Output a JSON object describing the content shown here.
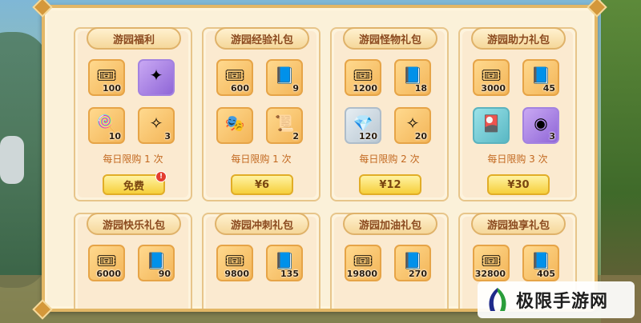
{
  "colors": {
    "accent": "#f6cf3b",
    "title": "#8b4a1f",
    "limit_text": "#c2681f",
    "panel": "#fbf1d9"
  },
  "packs": [
    {
      "title": "游园福利",
      "items": [
        {
          "icon": "ticket-icon",
          "qty": "100"
        },
        {
          "icon": "purple-crystal-icon",
          "qty": ""
        },
        {
          "icon": "lollipop-icon",
          "qty": "10"
        },
        {
          "icon": "gem-icon",
          "qty": "3"
        }
      ],
      "limit": "每日限购 1 次",
      "price": "免费",
      "badge": "!"
    },
    {
      "title": "游园经验礼包",
      "items": [
        {
          "icon": "ticket-icon",
          "qty": "600"
        },
        {
          "icon": "book-icon",
          "qty": "9"
        },
        {
          "icon": "mask-icon",
          "qty": ""
        },
        {
          "icon": "scroll-icon",
          "qty": "2"
        }
      ],
      "limit": "每日限购 1 次",
      "price": "¥6"
    },
    {
      "title": "游园怪物礼包",
      "items": [
        {
          "icon": "ticket-icon",
          "qty": "1200"
        },
        {
          "icon": "book-icon",
          "qty": "18"
        },
        {
          "icon": "crystal-icon",
          "qty": "120"
        },
        {
          "icon": "gem-icon",
          "qty": "20"
        }
      ],
      "limit": "每日限购 2 次",
      "price": "¥12"
    },
    {
      "title": "游园助力礼包",
      "items": [
        {
          "icon": "ticket-icon",
          "qty": "3000"
        },
        {
          "icon": "book-icon",
          "qty": "45"
        },
        {
          "icon": "card-icon",
          "qty": ""
        },
        {
          "icon": "eye-orb-icon",
          "qty": "3"
        }
      ],
      "limit": "每日限购 3 次",
      "price": "¥30"
    },
    {
      "title": "游园快乐礼包",
      "items": [
        {
          "icon": "ticket-icon",
          "qty": "6000"
        },
        {
          "icon": "book-icon",
          "qty": "90"
        }
      ]
    },
    {
      "title": "游园冲刺礼包",
      "items": [
        {
          "icon": "ticket-icon",
          "qty": "9800"
        },
        {
          "icon": "book-icon",
          "qty": "135"
        }
      ]
    },
    {
      "title": "游园加油礼包",
      "items": [
        {
          "icon": "ticket-icon",
          "qty": "19800"
        },
        {
          "icon": "book-icon",
          "qty": "270"
        }
      ]
    },
    {
      "title": "游园独享礼包",
      "items": [
        {
          "icon": "ticket-icon",
          "qty": "32800"
        },
        {
          "icon": "book-icon",
          "qty": "405"
        }
      ]
    }
  ],
  "watermark": {
    "text": "极限手游网"
  }
}
